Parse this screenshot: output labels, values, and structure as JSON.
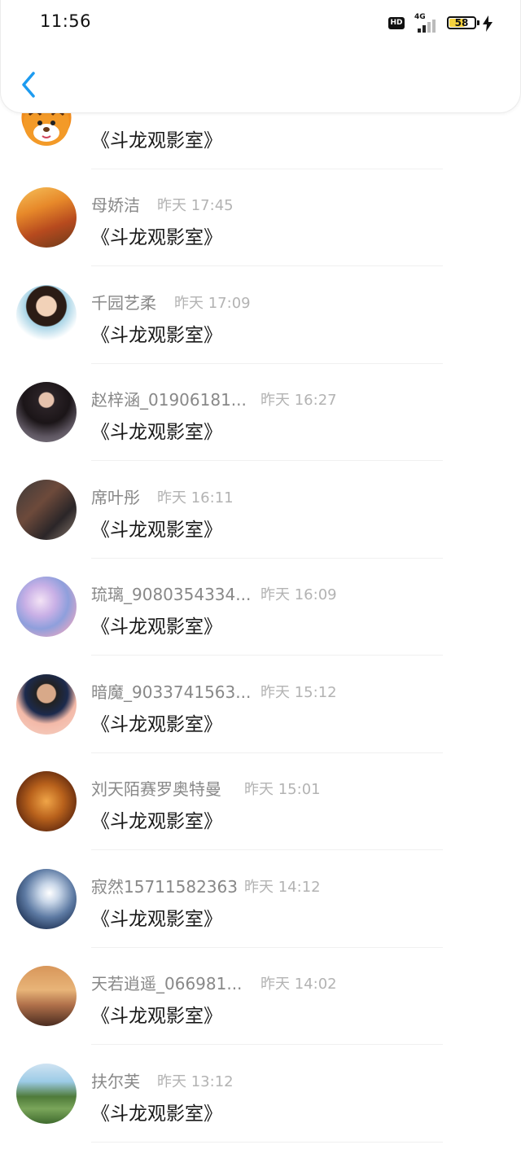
{
  "status_bar": {
    "time": "11:56",
    "hd_label": "HD",
    "network_label": "4G",
    "battery_level": "58",
    "charging": true
  },
  "header": {
    "back_icon": "chevron-left-icon",
    "accent_color": "#1d9bf0"
  },
  "messages": [
    {
      "name": "",
      "time": "",
      "text": "《斗龙观影室》",
      "avatar": "tiger-cartoon"
    },
    {
      "name": "母娇洁",
      "time": "昨天 17:45",
      "text": "《斗龙观影室》",
      "avatar": "autumn-road"
    },
    {
      "name": "千园艺柔",
      "time": "昨天 17:09",
      "text": "《斗龙观影室》",
      "avatar": "woman-portrait"
    },
    {
      "name": "赵梓涵_01906181...",
      "time": "昨天 16:27",
      "text": "《斗龙观影室》",
      "avatar": "woman-black-dress"
    },
    {
      "name": "席叶彤",
      "time": "昨天 16:11",
      "text": "《斗龙观影室》",
      "avatar": "man-car"
    },
    {
      "name": "琉璃_9080354334...",
      "time": "昨天 16:09",
      "text": "《斗龙观影室》",
      "avatar": "anime-girl"
    },
    {
      "name": "暗魔_9033741563...",
      "time": "昨天 15:12",
      "text": "《斗龙观影室》",
      "avatar": "young-man"
    },
    {
      "name": "刘天陌赛罗奥特曼",
      "time": "昨天 15:01",
      "text": "《斗龙观影室》",
      "avatar": "lion"
    },
    {
      "name": "寂然15711582363",
      "time": "昨天 14:12",
      "text": "《斗龙观影室》",
      "avatar": "white-hair-figure"
    },
    {
      "name": "天若逍遥_066981...",
      "time": "昨天 14:02",
      "text": "《斗龙观影室》",
      "avatar": "sunset-silhouette"
    },
    {
      "name": "扶尔芙",
      "time": "昨天 13:12",
      "text": "《斗龙观影室》",
      "avatar": "green-field"
    }
  ]
}
